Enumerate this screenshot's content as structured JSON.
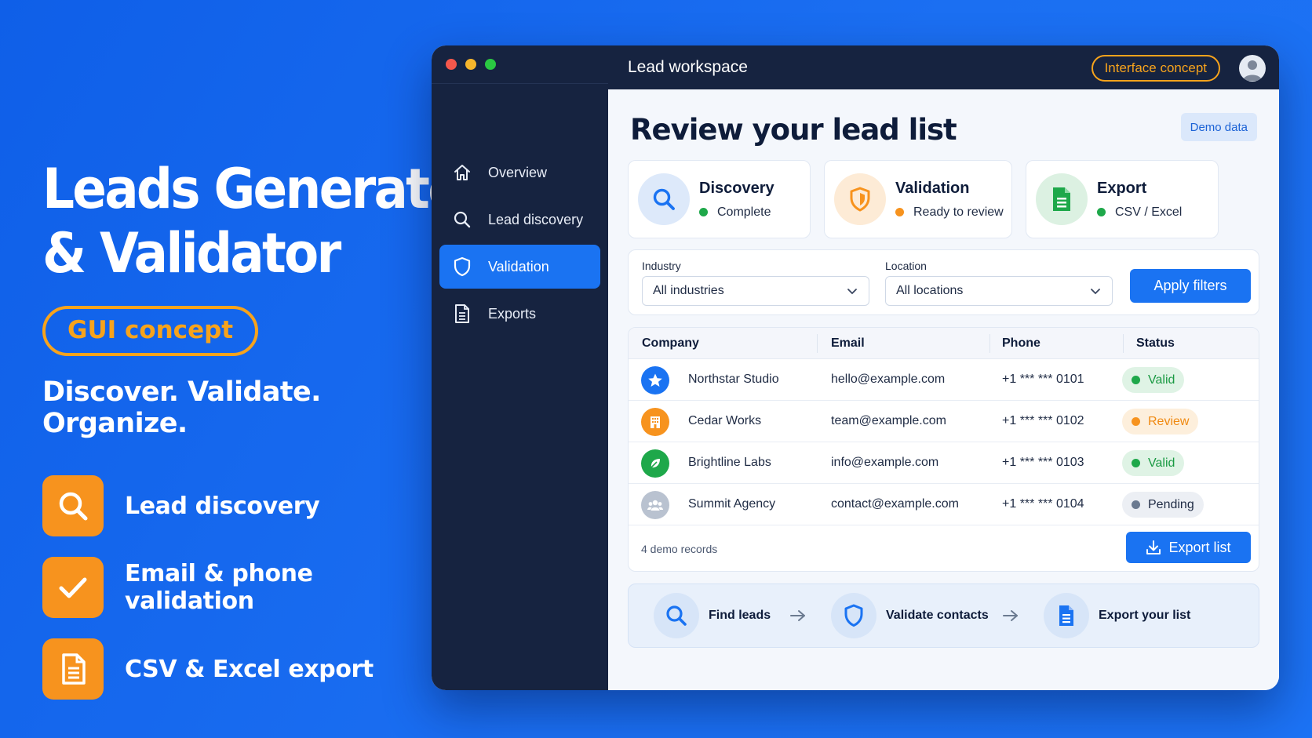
{
  "promo": {
    "title_line1": "Leads Generator",
    "title_line2": "& Validator",
    "badge": "GUI concept",
    "tagline": "Discover. Validate. Organize.",
    "features": [
      {
        "label": "Lead discovery",
        "icon": "search-icon"
      },
      {
        "label": "Email & phone validation",
        "icon": "check-icon"
      },
      {
        "label": "CSV & Excel export",
        "icon": "document-icon"
      }
    ]
  },
  "colors": {
    "brand_blue": "#1a73f2",
    "accent_orange": "#f7931e",
    "sidebar_navy": "#162340",
    "valid_green": "#1ea84a",
    "review_orange": "#f7931e",
    "pending_gray": "#6b7a90"
  },
  "window": {
    "topbar_title": "Lead workspace",
    "concept_pill": "Interface concept",
    "sidebar": {
      "items": [
        {
          "label": "Overview",
          "icon": "home-icon"
        },
        {
          "label": "Lead discovery",
          "icon": "search-icon"
        },
        {
          "label": "Validation",
          "icon": "shield-icon",
          "active": true
        },
        {
          "label": "Exports",
          "icon": "document-icon"
        }
      ]
    },
    "main": {
      "title": "Review your lead list",
      "demo_badge": "Demo data",
      "cards": [
        {
          "title": "Discovery",
          "status": "Complete",
          "icon": "search-icon"
        },
        {
          "title": "Validation",
          "status": "Ready to review",
          "icon": "shield-icon"
        },
        {
          "title": "Export",
          "status": "CSV / Excel",
          "icon": "spreadsheet-icon"
        }
      ],
      "filters": {
        "industry_label": "Industry",
        "industry_value": "All industries",
        "location_label": "Location",
        "location_value": "All locations",
        "apply_label": "Apply filters"
      },
      "table": {
        "columns": [
          "Company",
          "Email",
          "Phone",
          "Status"
        ],
        "rows": [
          {
            "company": "Northstar Studio",
            "email": "hello@example.com",
            "phone": "+1 *** *** 0101",
            "status": "Valid",
            "icon": "star-icon"
          },
          {
            "company": "Cedar Works",
            "email": "team@example.com",
            "phone": "+1 *** *** 0102",
            "status": "Review",
            "icon": "building-icon"
          },
          {
            "company": "Brightline Labs",
            "email": "info@example.com",
            "phone": "+1 *** *** 0103",
            "status": "Valid",
            "icon": "leaf-icon"
          },
          {
            "company": "Summit Agency",
            "email": "contact@example.com",
            "phone": "+1 *** *** 0104",
            "status": "Pending",
            "icon": "group-icon"
          }
        ],
        "records_text": "4 demo records",
        "export_label": "Export list"
      },
      "flow": [
        {
          "label": "Find leads",
          "icon": "search-icon"
        },
        {
          "label": "Validate contacts",
          "icon": "shield-icon"
        },
        {
          "label": "Export your list",
          "icon": "document-icon"
        }
      ]
    }
  }
}
